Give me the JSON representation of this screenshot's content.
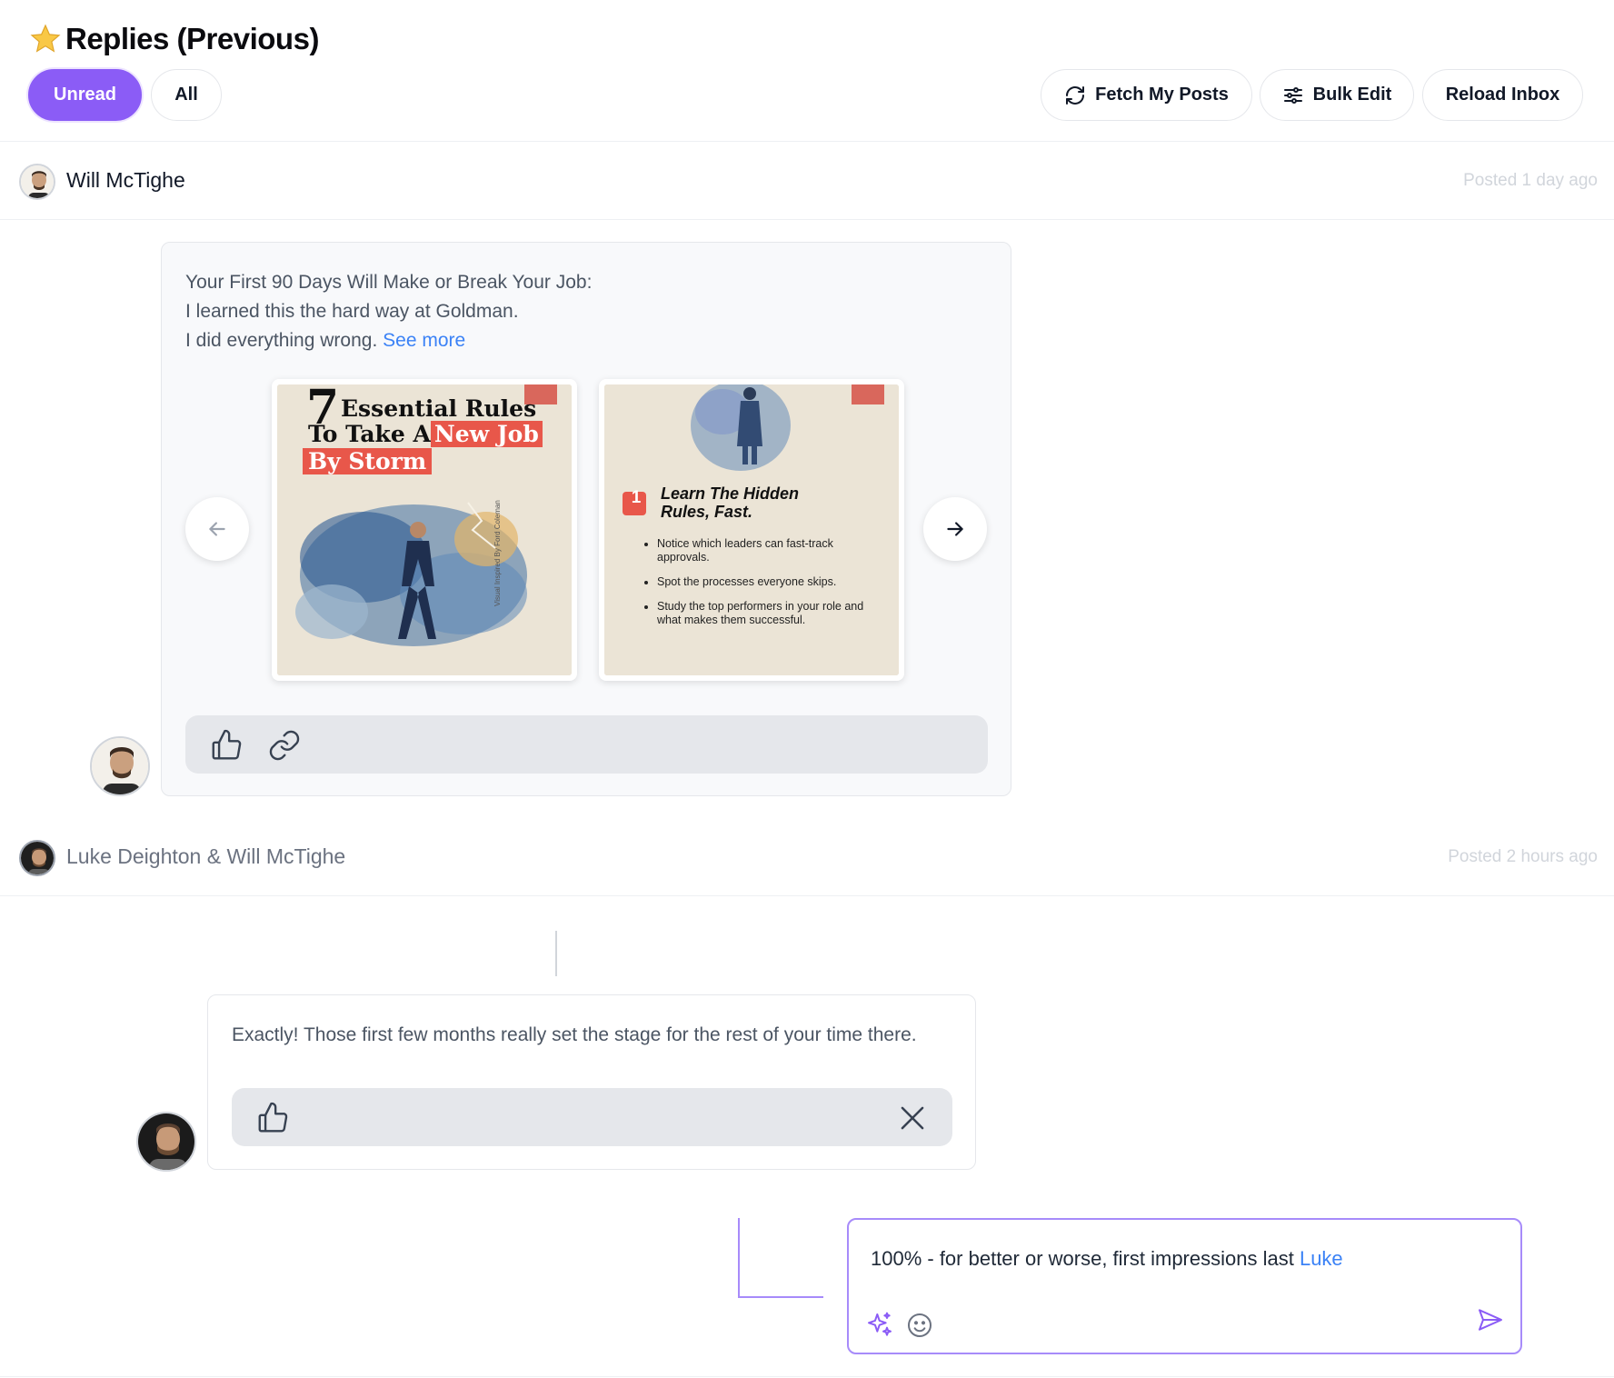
{
  "header": {
    "title": "Replies (Previous)",
    "tabs": [
      {
        "label": "Unread",
        "active": true
      },
      {
        "label": "All",
        "active": false
      }
    ],
    "actions": [
      {
        "label": "Fetch My Posts",
        "icon": "refresh-icon"
      },
      {
        "label": "Bulk Edit",
        "icon": "sliders-icon"
      },
      {
        "label": "Reload Inbox"
      }
    ]
  },
  "post": {
    "author": "Will McTighe",
    "posted": "Posted 1 day ago",
    "text_lines": [
      "Your First 90 Days Will Make or Break Your Job:",
      "I learned this the hard way at Goldman.",
      "I did everything wrong."
    ],
    "see_more": "See more",
    "slides": [
      {
        "big_number": "7",
        "title_line1": "Essential Rules",
        "title_line2a": "To Take A",
        "title_line2b": "New Job",
        "title_line3": "By Storm",
        "credit": "Visual Inspired By Ford Coleman"
      },
      {
        "badge": "1",
        "heading_line1": "Learn The Hidden",
        "heading_line2": "Rules, Fast.",
        "bullets": [
          "Notice which leaders can fast-track approvals.",
          "Spot the processes everyone skips.",
          "Study the top performers in your role and what makes them successful."
        ]
      }
    ]
  },
  "reply_thread": {
    "participants": "Luke Deighton & Will McTighe",
    "posted": "Posted 2 hours ago",
    "reply_text": "Exactly! Those first few months really set the stage for the rest of your time there.",
    "compose_text": "100% - for better or worse, first impressions last",
    "compose_mention": "Luke"
  },
  "colors": {
    "accent": "#8b5cf6",
    "link": "#3b82f6",
    "accent_border": "#a78bfa"
  }
}
